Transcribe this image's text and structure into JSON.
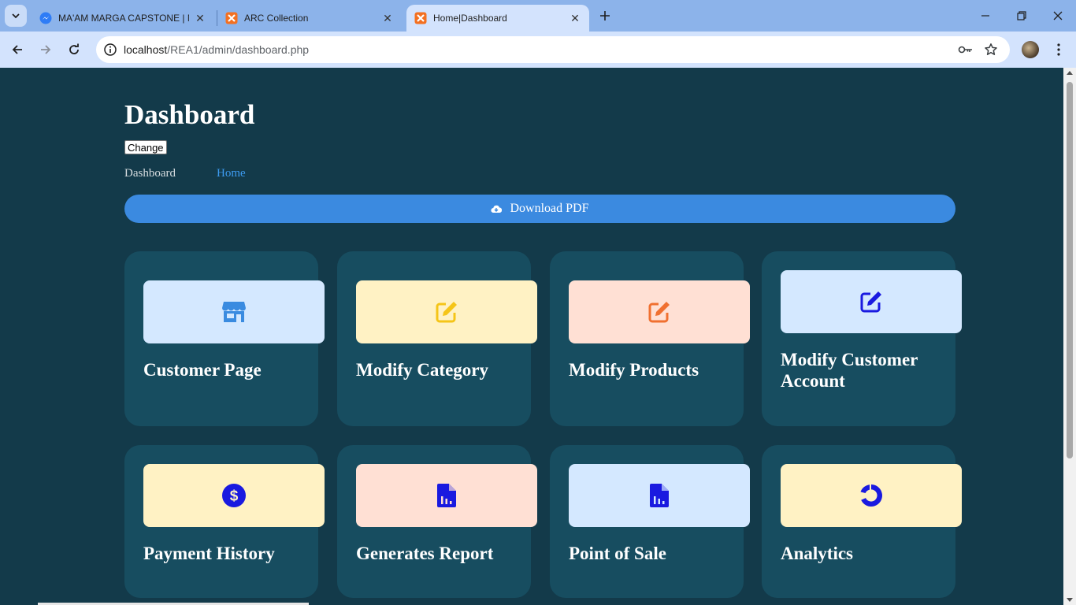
{
  "browser": {
    "tabs": [
      {
        "title": "MA'AM MARGA CAPSTONE | M",
        "icon": "messenger-icon"
      },
      {
        "title": "ARC Collection",
        "icon": "xampp-icon"
      },
      {
        "title": "Home|Dashboard",
        "icon": "xampp-icon",
        "active": true
      }
    ],
    "url_host": "localhost",
    "url_path": "/REA1/admin/dashboard.php"
  },
  "page": {
    "title": "Dashboard",
    "change_label": "Change",
    "breadcrumb": {
      "current": "Dashboard",
      "link": "Home"
    },
    "download_label": "Download PDF"
  },
  "cards": [
    {
      "label": "Customer Page",
      "icon": "store-icon",
      "banner": "#d4e8ff",
      "icon_color": "#3a8be0"
    },
    {
      "label": "Modify Category",
      "icon": "edit-icon",
      "banner": "#fff2c4",
      "icon_color": "#f5c518"
    },
    {
      "label": "Modify Products",
      "icon": "edit-icon",
      "banner": "#ffe0d4",
      "icon_color": "#f07030"
    },
    {
      "label": "Modify Customer Account",
      "icon": "edit-icon",
      "banner": "#d4e8ff",
      "icon_color": "#1a1ae0"
    },
    {
      "label": "Payment History",
      "icon": "dollar-icon",
      "banner": "#fff2c4",
      "icon_color": "#1a1ae0"
    },
    {
      "label": "Generates Report",
      "icon": "report-icon",
      "banner": "#ffe0d4",
      "icon_color": "#1a1ae0"
    },
    {
      "label": "Point of Sale",
      "icon": "report-icon",
      "banner": "#d4e8ff",
      "icon_color": "#1a1ae0"
    },
    {
      "label": "Analytics",
      "icon": "donut-chart-icon",
      "banner": "#fff2c4",
      "icon_color": "#1a1ae0"
    }
  ]
}
